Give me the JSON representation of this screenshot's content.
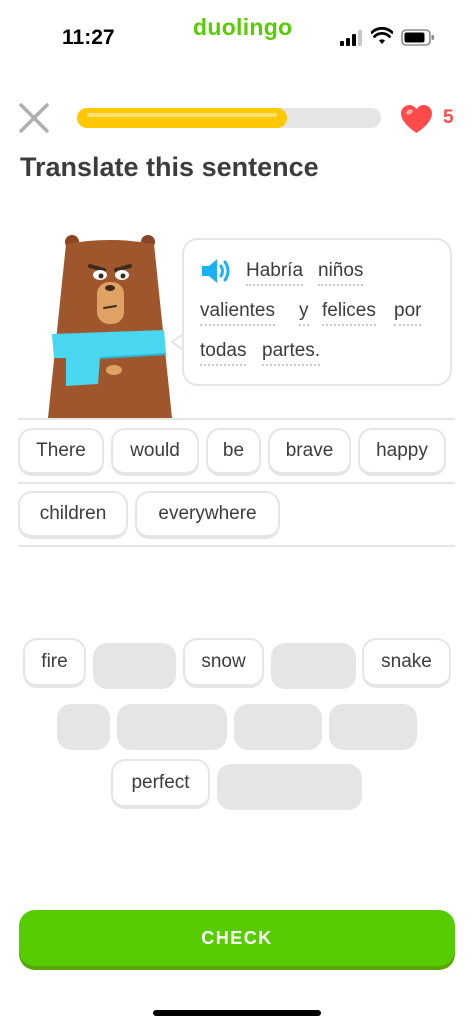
{
  "status_bar": {
    "time": "11:27",
    "app_name": "duolingo"
  },
  "header": {
    "progress": 0.69,
    "hearts": "5"
  },
  "prompt": {
    "title": "Translate this sentence",
    "sentence_words": [
      "Habría",
      "niños",
      "valientes",
      "y",
      "felices",
      "por",
      "todas",
      "partes."
    ]
  },
  "answer": {
    "selected_words": [
      "There",
      "would",
      "be",
      "brave",
      "happy",
      "children",
      "everywhere"
    ]
  },
  "word_bank": {
    "visible_words": [
      "fire",
      "snow",
      "snake",
      "perfect"
    ]
  },
  "actions": {
    "check_label": "CHECK"
  },
  "colors": {
    "brand_green": "#58cc02",
    "progress_yellow": "#ffc800",
    "heart_red": "#ff4b4b",
    "speaker_blue": "#1cb0f6",
    "bear_brown": "#a0562c",
    "scarf_cyan": "#49d6f0"
  },
  "icons": [
    "close-icon",
    "heart-icon",
    "speaker-icon",
    "signal-icon",
    "wifi-icon",
    "battery-icon"
  ]
}
